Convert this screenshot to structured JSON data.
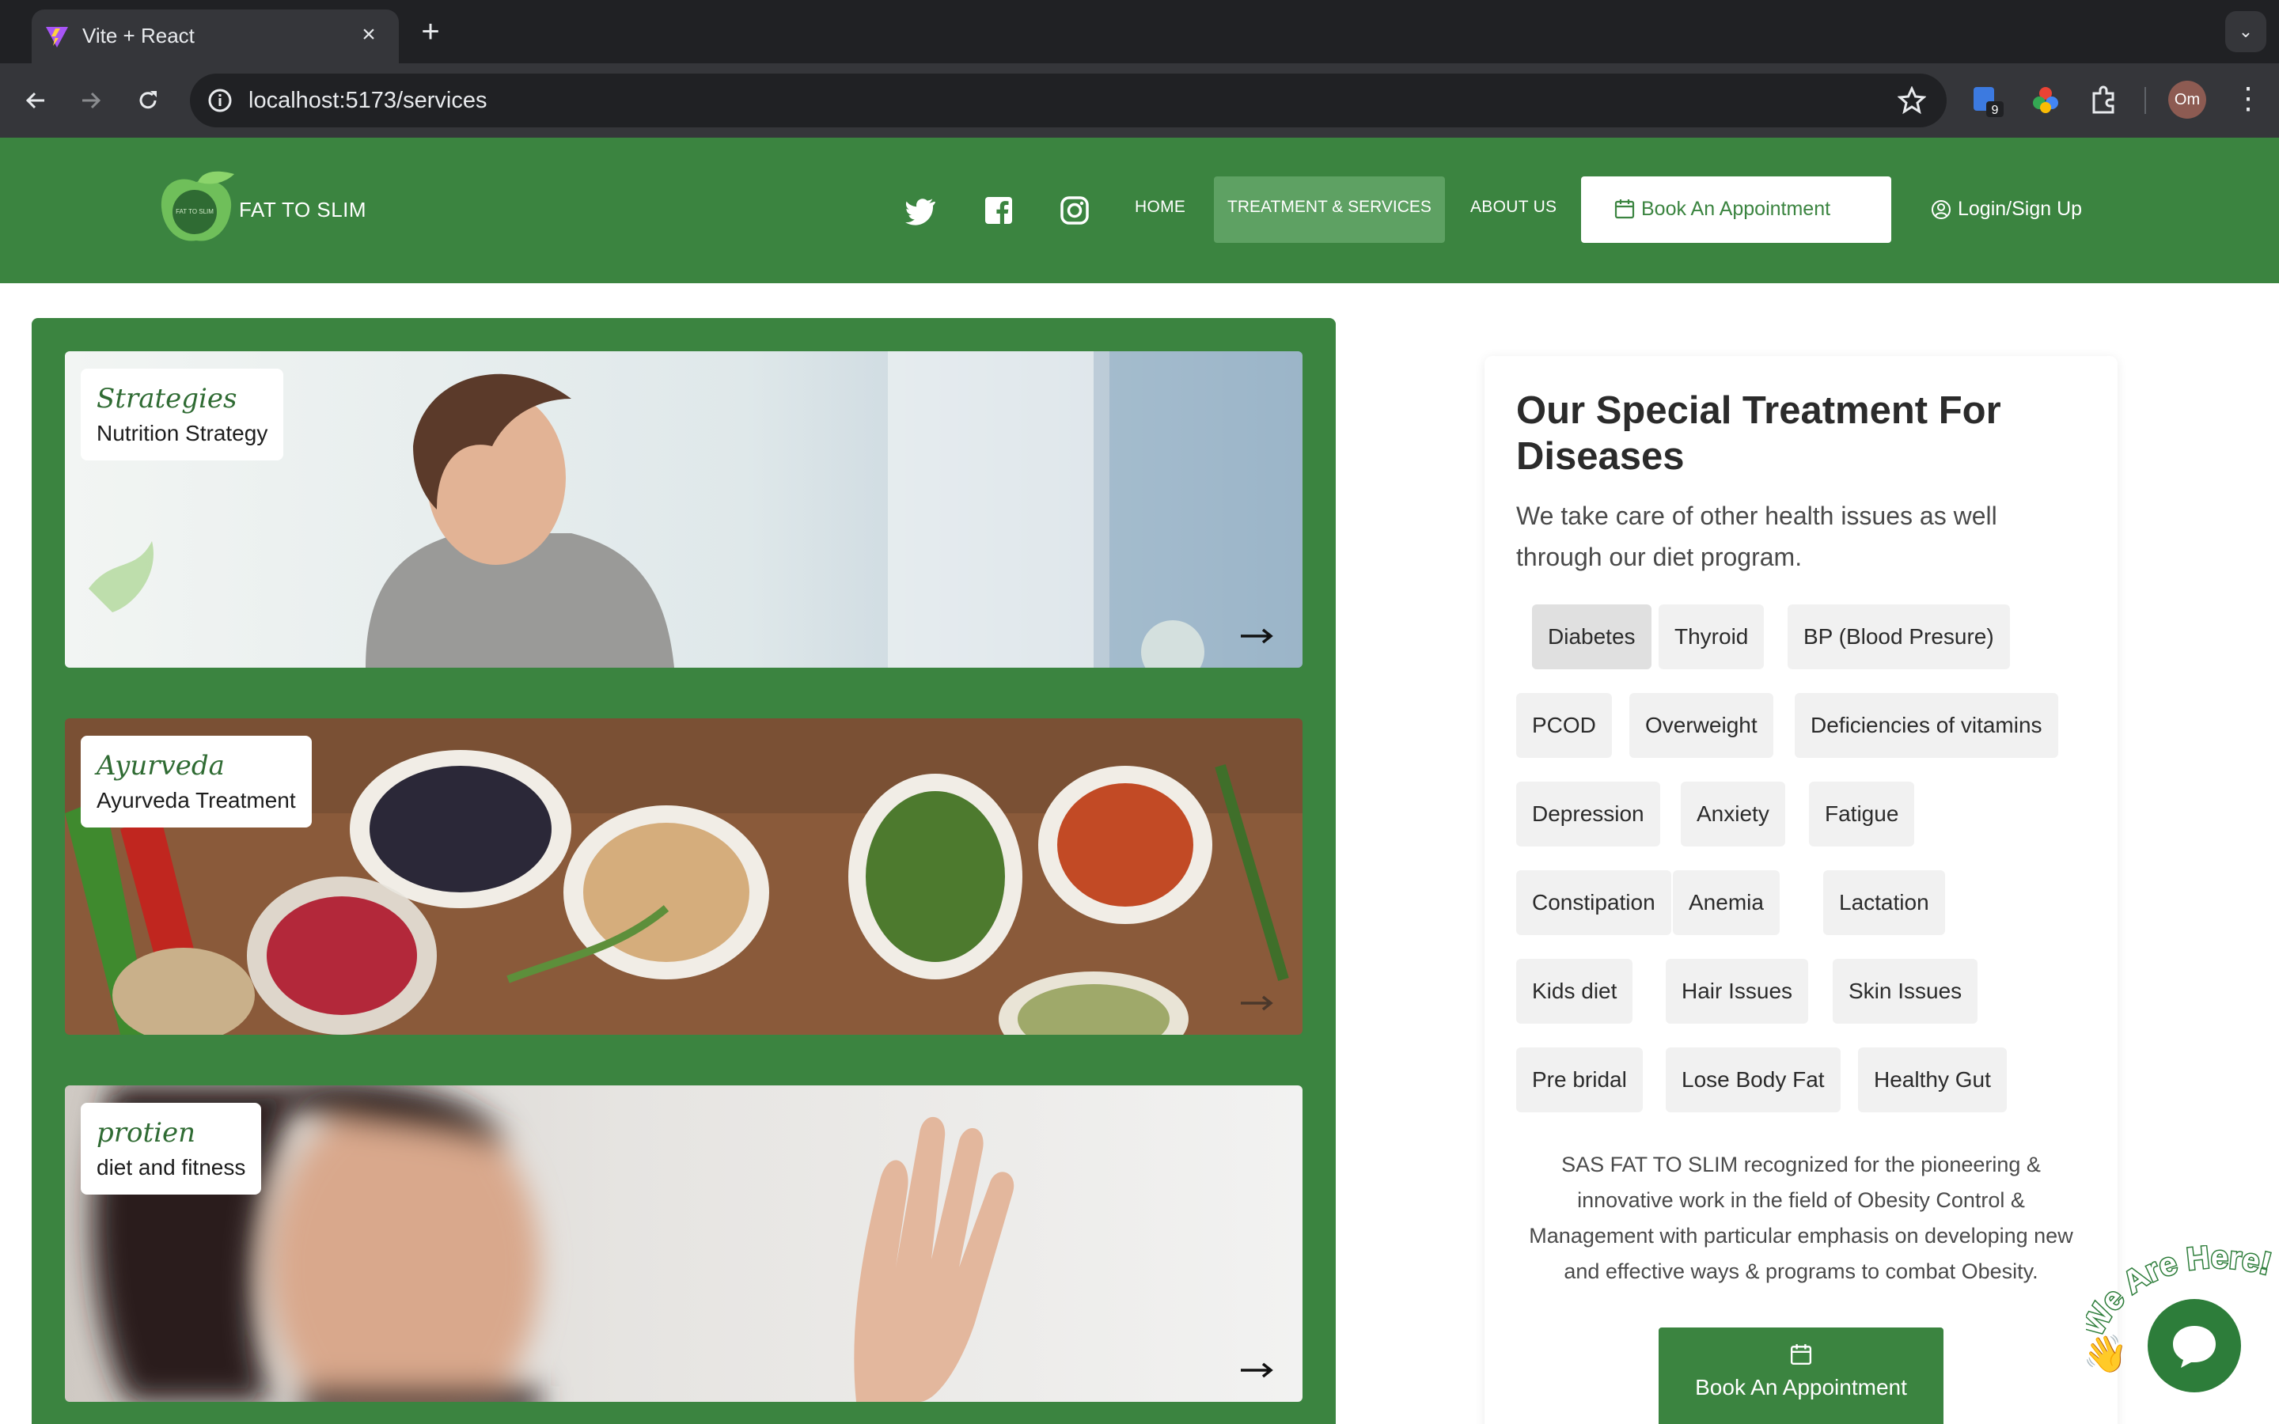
{
  "browser": {
    "tab_title": "Vite + React",
    "url": "localhost:5173/services",
    "extension_badge": "9",
    "profile_initials": "Om"
  },
  "header": {
    "brand": "FAT TO SLIM",
    "logo_text": "FAT TO SLIM",
    "nav": {
      "home": "HOME",
      "services": "TREATMENT & SERVICES",
      "about": "ABOUT US"
    },
    "book_button": "Book An Appointment",
    "login": "Login/Sign Up"
  },
  "cards": [
    {
      "script": "Strategies",
      "title": "Nutrition Strategy"
    },
    {
      "script": "Ayurveda",
      "title": "Ayurveda Treatment"
    },
    {
      "script": "protien",
      "title": "diet and fitness"
    }
  ],
  "treatments": {
    "title": "Our Special Treatment For Diseases",
    "subtitle": "We take care of other health issues as well through our diet program.",
    "chips": [
      "Diabetes",
      "Thyroid",
      "BP (Blood Presure)",
      "PCOD",
      "Overweight",
      "Deficiencies of vitamins",
      "Depression",
      "Anxiety",
      "Fatigue",
      "Constipation",
      "Anemia",
      "Lactation",
      "Kids diet",
      "Hair Issues",
      "Skin Issues",
      "Pre bridal",
      "Lose Body Fat",
      "Healthy Gut"
    ],
    "selected_chip": "Diabetes",
    "description": "SAS FAT TO SLIM recognized for the pioneering & innovative work in the field of Obesity Control & Management with particular emphasis on developing new and effective ways & programs to combat Obesity.",
    "book_button": "Book An Appointment"
  },
  "chat_widget": {
    "tagline": "We Are Here!"
  },
  "colors": {
    "brand_green": "#3b8440",
    "active_nav": "#5ea163",
    "chat_green": "#2d7d3a"
  }
}
